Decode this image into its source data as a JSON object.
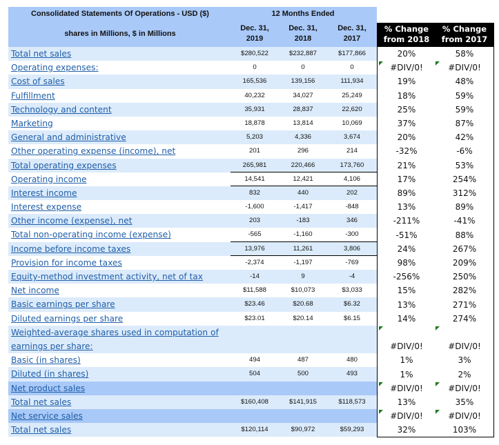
{
  "header": {
    "title": "Consolidated Statements Of Operations - USD ($)",
    "subtitle": "shares in Millions, $ in Millions",
    "period_group": "12 Months Ended",
    "columns": [
      {
        "line1": "Dec. 31,",
        "line2": "2019"
      },
      {
        "line1": "Dec. 31,",
        "line2": "2018"
      },
      {
        "line1": "Dec. 31,",
        "line2": "2017"
      }
    ],
    "pct_columns": [
      {
        "line1": "% Change",
        "line2": "from 2018"
      },
      {
        "line1": "% Change",
        "line2": "from 2017"
      }
    ]
  },
  "rows": [
    {
      "label": "Total net sales",
      "values": [
        "$280,522",
        "$232,887",
        "$177,866"
      ],
      "pct": [
        "20%",
        "58%"
      ],
      "style": "light",
      "err": [
        false,
        false
      ]
    },
    {
      "label": "Operating expenses:",
      "values": [
        "0",
        "0",
        "0"
      ],
      "pct": [
        "#DIV/0!",
        "#DIV/0!"
      ],
      "style": "white",
      "err": [
        true,
        true
      ]
    },
    {
      "label": "Cost of sales",
      "values": [
        "165,536",
        "139,156",
        "111,934"
      ],
      "pct": [
        "19%",
        "48%"
      ],
      "style": "light",
      "err": [
        false,
        false
      ]
    },
    {
      "label": "Fulfillment",
      "values": [
        "40,232",
        "34,027",
        "25,249"
      ],
      "pct": [
        "18%",
        "59%"
      ],
      "style": "white",
      "err": [
        false,
        false
      ]
    },
    {
      "label": "Technology and content",
      "values": [
        "35,931",
        "28,837",
        "22,620"
      ],
      "pct": [
        "25%",
        "59%"
      ],
      "style": "light",
      "err": [
        false,
        false
      ]
    },
    {
      "label": "Marketing",
      "values": [
        "18,878",
        "13,814",
        "10,069"
      ],
      "pct": [
        "37%",
        "87%"
      ],
      "style": "white",
      "err": [
        false,
        false
      ]
    },
    {
      "label": "General and administrative",
      "values": [
        "5,203",
        "4,336",
        "3,674"
      ],
      "pct": [
        "20%",
        "42%"
      ],
      "style": "light",
      "err": [
        false,
        false
      ]
    },
    {
      "label": "Other operating expense (income), net",
      "values": [
        "201",
        "296",
        "214"
      ],
      "pct": [
        "-32%",
        "-6%"
      ],
      "style": "white",
      "err": [
        false,
        false
      ]
    },
    {
      "label": "Total operating expenses",
      "values": [
        "265,981",
        "220,466",
        "173,760"
      ],
      "pct": [
        "21%",
        "53%"
      ],
      "style": "light",
      "err": [
        false,
        false
      ]
    },
    {
      "label": "Operating income",
      "values": [
        "14,541",
        "12,421",
        "4,106"
      ],
      "pct": [
        "17%",
        "254%"
      ],
      "style": "white",
      "err": [
        false,
        false
      ]
    },
    {
      "label": "Interest income",
      "values": [
        "832",
        "440",
        "202"
      ],
      "pct": [
        "89%",
        "312%"
      ],
      "style": "light",
      "err": [
        false,
        false
      ]
    },
    {
      "label": "Interest expense",
      "values": [
        "-1,600",
        "-1,417",
        "-848"
      ],
      "pct": [
        "13%",
        "89%"
      ],
      "style": "white",
      "err": [
        false,
        false
      ]
    },
    {
      "label": "Other income (expense), net",
      "values": [
        "203",
        "-183",
        "346"
      ],
      "pct": [
        "-211%",
        "-41%"
      ],
      "style": "light",
      "err": [
        false,
        false
      ]
    },
    {
      "label": "Total non-operating income (expense)",
      "values": [
        "-565",
        "-1,160",
        "-300"
      ],
      "pct": [
        "-51%",
        "88%"
      ],
      "style": "white",
      "err": [
        false,
        false
      ]
    },
    {
      "label": "Income before income taxes",
      "values": [
        "13,976",
        "11,261",
        "3,806"
      ],
      "pct": [
        "24%",
        "267%"
      ],
      "style": "light",
      "err": [
        false,
        false
      ]
    },
    {
      "label": "Provision for income taxes",
      "values": [
        "-2,374",
        "-1,197",
        "-769"
      ],
      "pct": [
        "98%",
        "209%"
      ],
      "style": "white",
      "err": [
        false,
        false
      ]
    },
    {
      "label": "Equity-method investment activity, net of tax",
      "values": [
        "-14",
        "9",
        "-4"
      ],
      "pct": [
        "-256%",
        "250%"
      ],
      "style": "light",
      "err": [
        false,
        false
      ]
    },
    {
      "label": "Net income",
      "values": [
        "$11,588",
        "$10,073",
        "$3,033"
      ],
      "pct": [
        "15%",
        "282%"
      ],
      "style": "white",
      "err": [
        false,
        false
      ]
    },
    {
      "label": "Basic earnings per share",
      "values": [
        "$23.46",
        "$20.68",
        "$6.32"
      ],
      "pct": [
        "13%",
        "271%"
      ],
      "style": "light",
      "err": [
        false,
        false
      ]
    },
    {
      "label": "Diluted earnings per share",
      "values": [
        "$23.01",
        "$20.14",
        "$6.15"
      ],
      "pct": [
        "14%",
        "274%"
      ],
      "style": "white",
      "err": [
        false,
        false
      ]
    },
    {
      "label": "Weighted-average shares used in computation of earnings per share:",
      "values": [
        "",
        "",
        ""
      ],
      "pct": [
        "#DIV/0!",
        "#DIV/0!"
      ],
      "style": "light",
      "tall": true,
      "err": [
        true,
        true
      ]
    },
    {
      "label": "Basic (in shares)",
      "values": [
        "494",
        "487",
        "480"
      ],
      "pct": [
        "1%",
        "3%"
      ],
      "style": "white",
      "err": [
        false,
        false
      ]
    },
    {
      "label": "Diluted (in shares)",
      "values": [
        "504",
        "500",
        "493"
      ],
      "pct": [
        "1%",
        "2%"
      ],
      "style": "light",
      "err": [
        false,
        false
      ]
    },
    {
      "label": "Net product sales",
      "values": [
        "",
        "",
        ""
      ],
      "pct": [
        "#DIV/0!",
        "#DIV/0!"
      ],
      "style": "mid",
      "err": [
        true,
        true
      ]
    },
    {
      "label": "Total net sales",
      "values": [
        "$160,408",
        "$141,915",
        "$118,573"
      ],
      "pct": [
        "13%",
        "35%"
      ],
      "style": "light",
      "err": [
        false,
        false
      ]
    },
    {
      "label": "Net service sales",
      "values": [
        "",
        "",
        ""
      ],
      "pct": [
        "#DIV/0!",
        "#DIV/0!"
      ],
      "style": "mid",
      "err": [
        true,
        true
      ]
    },
    {
      "label": "Total net sales",
      "values": [
        "$120,114",
        "$90,972",
        "$59,293"
      ],
      "pct": [
        "32%",
        "103%"
      ],
      "style": "light",
      "err": [
        false,
        false
      ]
    }
  ],
  "colors": {
    "header_bg": "#a9c9f8",
    "row_light": "#dcebfb",
    "link_text": "#1f5ea8",
    "error_indicator": "#1a7a1a",
    "pct_header_bg": "#000000"
  }
}
